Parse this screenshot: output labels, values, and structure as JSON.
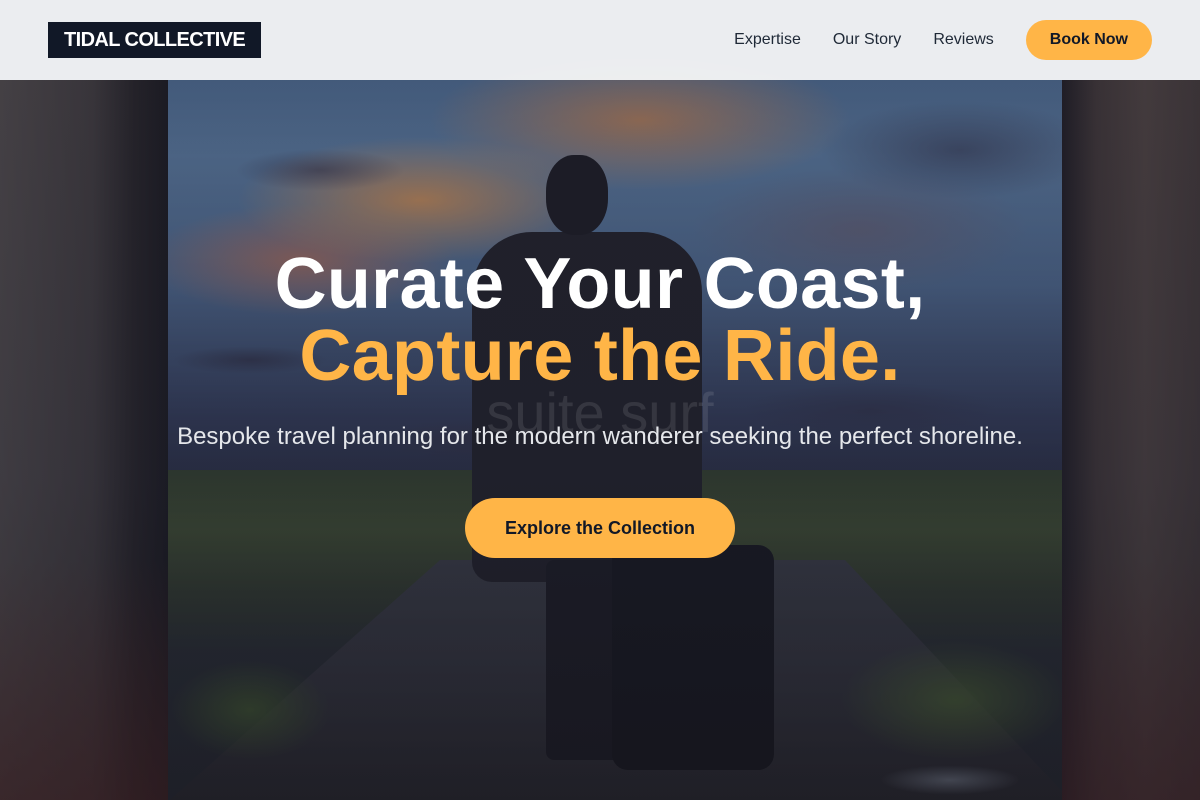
{
  "header": {
    "logo": "TIDAL COLLECTIVE",
    "nav": [
      {
        "label": "Expertise"
      },
      {
        "label": "Our Story"
      },
      {
        "label": "Reviews"
      }
    ],
    "cta_label": "Book Now"
  },
  "hero": {
    "headline_line1": "Curate Your Coast,",
    "headline_line2": "Capture the Ride.",
    "subtitle": "Bespoke travel planning for the modern wanderer seeking the perfect shoreline.",
    "cta_label": "Explore the Collection",
    "background_watermark": "suite surf"
  },
  "colors": {
    "accent": "#FFB547",
    "logo_background": "#111827",
    "header_background": "#F4F5F7"
  }
}
